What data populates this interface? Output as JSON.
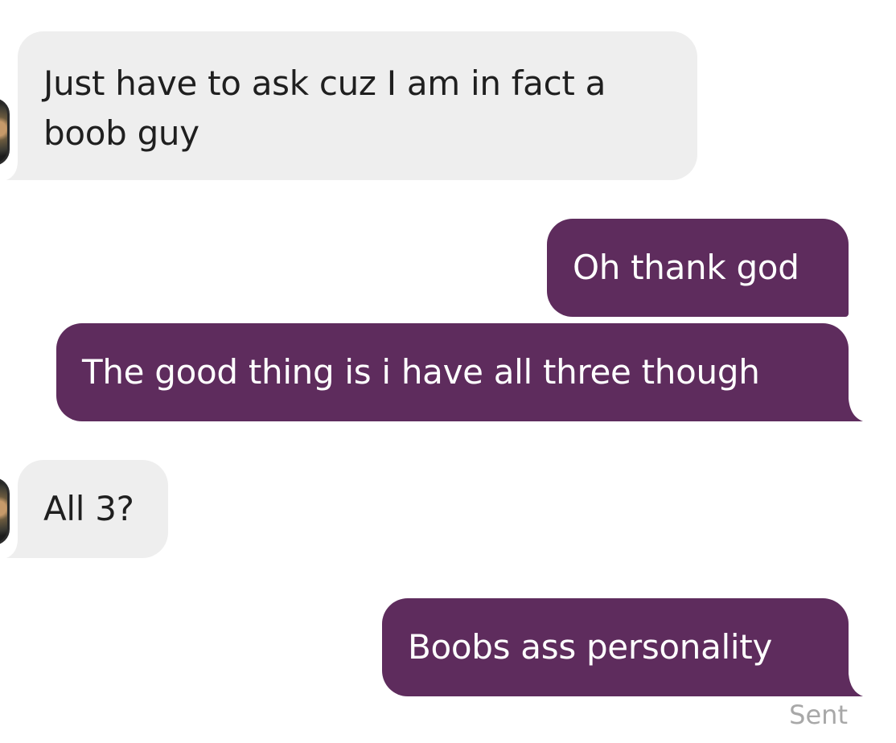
{
  "conversation": {
    "messages": [
      {
        "sender": "them",
        "text": "Just have to ask cuz I am in fact a boob guy"
      },
      {
        "sender": "me",
        "text": "Oh thank god"
      },
      {
        "sender": "me",
        "text": "The good thing is i have all three though"
      },
      {
        "sender": "them",
        "text": "All 3?"
      },
      {
        "sender": "me",
        "text": "Boobs ass personality"
      }
    ],
    "status": "Sent"
  },
  "colors": {
    "sent_bubble": "#5e2c5d",
    "received_bubble": "#eeeeee",
    "status_text": "#a8a8a8"
  },
  "icons": {
    "avatar": "contact-avatar"
  }
}
